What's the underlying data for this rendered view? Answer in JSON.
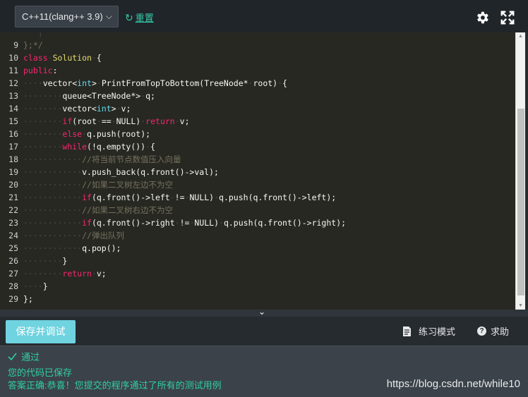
{
  "toolbar": {
    "language": "C++11(clang++ 3.9)",
    "reset_label": "重置",
    "settings_icon": "gear-icon",
    "fullscreen_icon": "expand-icon"
  },
  "editor": {
    "lines": [
      {
        "n": "",
        "seg": [
          [
            "ws",
            "   |"
          ]
        ]
      },
      {
        "n": "9",
        "seg": [
          [
            "cm",
            "};*/"
          ]
        ]
      },
      {
        "n": "10",
        "seg": [
          [
            "kw",
            "class"
          ],
          [
            "ws",
            "·"
          ],
          [
            "cls",
            "Solution"
          ],
          [
            "ws",
            "·"
          ],
          [
            "code",
            "{"
          ]
        ]
      },
      {
        "n": "11",
        "seg": [
          [
            "kw",
            "public"
          ],
          [
            "code",
            ":"
          ]
        ]
      },
      {
        "n": "12",
        "seg": [
          [
            "ws",
            "····"
          ],
          [
            "code",
            "vector<"
          ],
          [
            "ty",
            "int"
          ],
          [
            "code",
            ">"
          ],
          [
            "ws",
            "·"
          ],
          [
            "code",
            "PrintFromTopToBottom(TreeNode*"
          ],
          [
            "ws",
            "·"
          ],
          [
            "code",
            "root)"
          ],
          [
            "ws",
            "·"
          ],
          [
            "code",
            "{"
          ]
        ]
      },
      {
        "n": "13",
        "seg": [
          [
            "ws",
            "········"
          ],
          [
            "code",
            "queue<TreeNode*>"
          ],
          [
            "ws",
            "·"
          ],
          [
            "code",
            "q;"
          ]
        ]
      },
      {
        "n": "14",
        "seg": [
          [
            "ws",
            "········"
          ],
          [
            "code",
            "vector<"
          ],
          [
            "ty",
            "int"
          ],
          [
            "code",
            ">"
          ],
          [
            "ws",
            "·"
          ],
          [
            "code",
            "v;"
          ]
        ]
      },
      {
        "n": "15",
        "seg": [
          [
            "ws",
            "········"
          ],
          [
            "kw",
            "if"
          ],
          [
            "code",
            "(root"
          ],
          [
            "ws",
            "·"
          ],
          [
            "code",
            "=="
          ],
          [
            "ws",
            "·"
          ],
          [
            "code",
            "NULL)"
          ],
          [
            "ws",
            "·"
          ],
          [
            "kw",
            "return"
          ],
          [
            "ws",
            "·"
          ],
          [
            "code",
            "v;"
          ]
        ]
      },
      {
        "n": "16",
        "seg": [
          [
            "ws",
            "········"
          ],
          [
            "kw",
            "else"
          ],
          [
            "ws",
            "·"
          ],
          [
            "code",
            "q.push(root);"
          ]
        ]
      },
      {
        "n": "17",
        "seg": [
          [
            "ws",
            "········"
          ],
          [
            "kw",
            "while"
          ],
          [
            "code",
            "(!q.empty())"
          ],
          [
            "ws",
            "·"
          ],
          [
            "code",
            "{"
          ]
        ]
      },
      {
        "n": "18",
        "seg": [
          [
            "ws",
            "············"
          ],
          [
            "cm",
            "//将当前节点数值压入向量"
          ]
        ]
      },
      {
        "n": "19",
        "seg": [
          [
            "ws",
            "············"
          ],
          [
            "code",
            "v.push_back(q.front()->val);"
          ]
        ]
      },
      {
        "n": "20",
        "seg": [
          [
            "ws",
            "············"
          ],
          [
            "cm",
            "//如果二叉树左边不为空"
          ]
        ]
      },
      {
        "n": "21",
        "seg": [
          [
            "ws",
            "············"
          ],
          [
            "kw",
            "if"
          ],
          [
            "code",
            "(q.front()->left"
          ],
          [
            "ws",
            "·"
          ],
          [
            "code",
            "!="
          ],
          [
            "ws",
            "·"
          ],
          [
            "code",
            "NULL)"
          ],
          [
            "ws",
            "·"
          ],
          [
            "code",
            "q.push(q.front()->left);"
          ]
        ]
      },
      {
        "n": "22",
        "seg": [
          [
            "ws",
            "············"
          ],
          [
            "cm",
            "//如果二叉树右边不为空"
          ]
        ]
      },
      {
        "n": "23",
        "seg": [
          [
            "ws",
            "············"
          ],
          [
            "kw",
            "if"
          ],
          [
            "code",
            "(q.front()->right"
          ],
          [
            "ws",
            "·"
          ],
          [
            "code",
            "!="
          ],
          [
            "ws",
            "·"
          ],
          [
            "code",
            "NULL)"
          ],
          [
            "ws",
            "·"
          ],
          [
            "code",
            "q.push(q.front()->right);"
          ]
        ]
      },
      {
        "n": "24",
        "seg": [
          [
            "ws",
            "············"
          ],
          [
            "cm",
            "//弹出队列"
          ]
        ]
      },
      {
        "n": "25",
        "seg": [
          [
            "ws",
            "············"
          ],
          [
            "code",
            "q.pop();"
          ]
        ]
      },
      {
        "n": "26",
        "seg": [
          [
            "ws",
            "········"
          ],
          [
            "code",
            "}"
          ]
        ]
      },
      {
        "n": "27",
        "seg": [
          [
            "ws",
            "········"
          ],
          [
            "kw",
            "return"
          ],
          [
            "ws",
            "·"
          ],
          [
            "code",
            "v;"
          ]
        ]
      },
      {
        "n": "28",
        "seg": [
          [
            "ws",
            "····"
          ],
          [
            "code",
            "}"
          ]
        ]
      },
      {
        "n": "29",
        "seg": [
          [
            "code",
            "};"
          ]
        ]
      }
    ]
  },
  "actions": {
    "run_label": "保存并调试",
    "practice_label": "练习模式",
    "help_label": "求助"
  },
  "result": {
    "status": "通过",
    "saved": "您的代码已保存",
    "message": "答案正确:恭喜！您提交的程序通过了所有的测试用例"
  },
  "watermark": "https://blog.csdn.net/while10"
}
